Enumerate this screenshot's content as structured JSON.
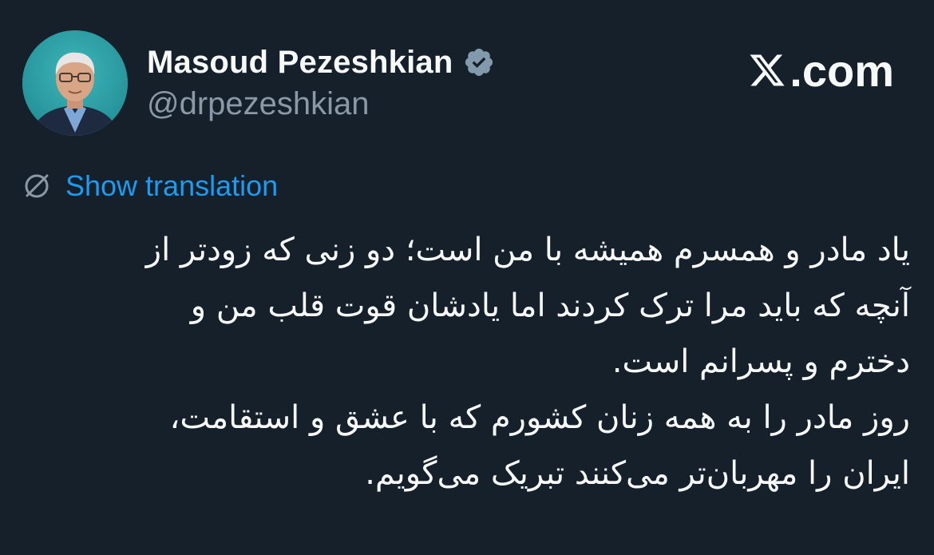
{
  "author": {
    "display_name": "Masoud Pezeshkian",
    "handle": "@drpezeshkian",
    "verified_icon": "verified-badge-icon",
    "avatar_icon": "profile-photo"
  },
  "brand": {
    "logo_icon": "x-logo-icon",
    "text": ".com"
  },
  "translation": {
    "icon": "globe-slash-icon",
    "label": "Show translation"
  },
  "tweet": {
    "lines": [
      "یاد مادر و همسرم همیشه با من است؛ دو زنی که زودتر از",
      "آنچه که باید مرا ترک کردند اما یادشان قوت قلب من و",
      "دخترم و پسرانم است.",
      "روز مادر را به همه زنان کشورم که با عشق و استقامت،",
      "ایران را مهربان‌تر می‌کنند تبریک می‌گویم."
    ]
  },
  "colors": {
    "background": "#15202b",
    "text": "#f7f9f9",
    "secondary": "#8b98a5",
    "link": "#1d9bf0",
    "badge": "#829aab"
  }
}
